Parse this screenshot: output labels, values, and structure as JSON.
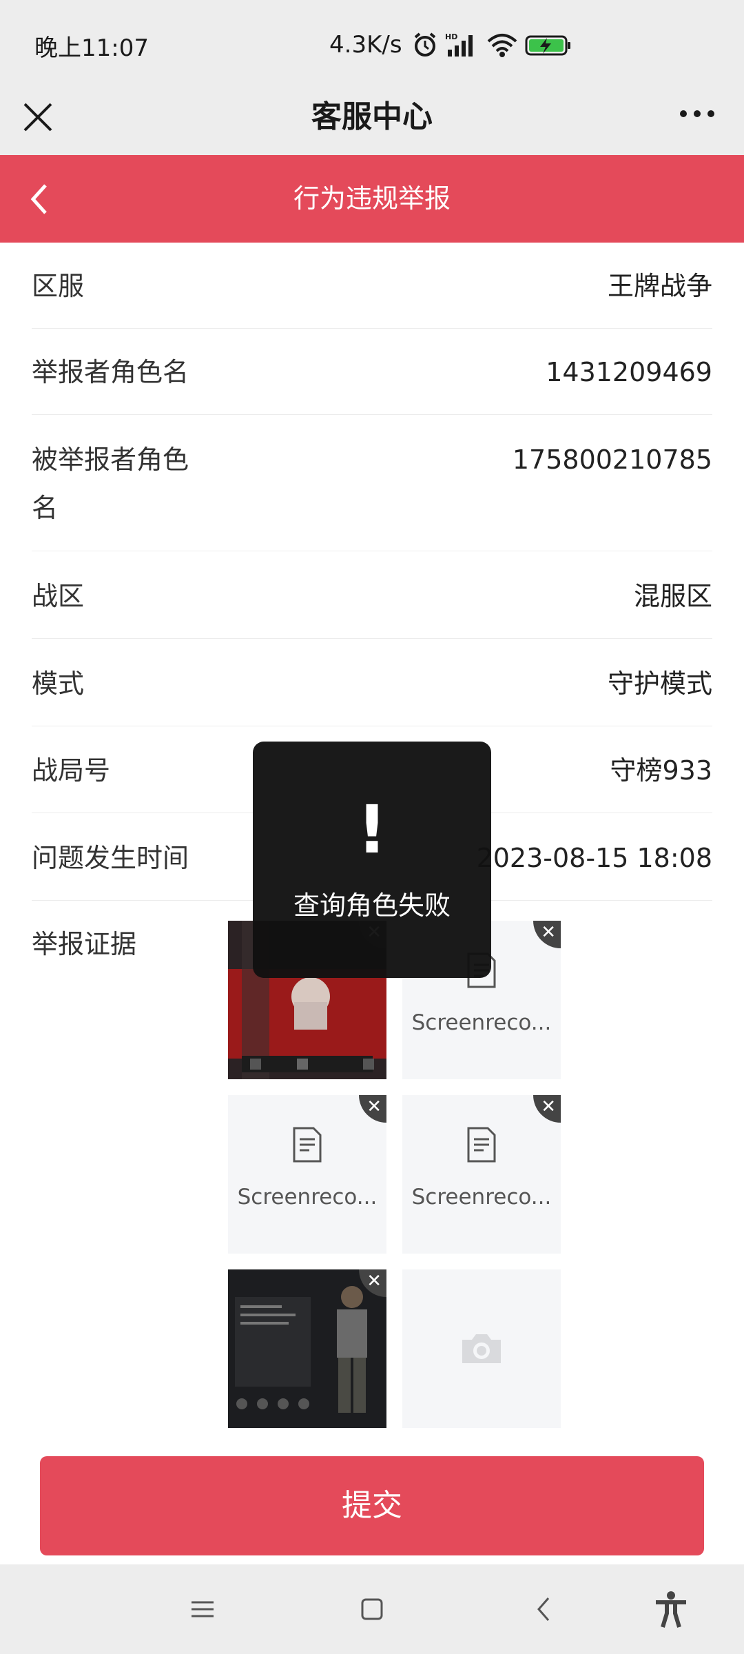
{
  "status_bar": {
    "time": "晚上11:07",
    "net_speed": "4.3K/s",
    "icons": [
      "alarm-icon",
      "hd-signal-icon",
      "wifi-icon",
      "battery-charging-icon"
    ]
  },
  "wechat_bar": {
    "title": "客服中心",
    "close_icon": "close-icon",
    "more_icon": "more-icon"
  },
  "header": {
    "title": "行为违规举报",
    "back_icon": "chevron-left-icon"
  },
  "form": {
    "rows": [
      {
        "label": "区服",
        "value": "王牌战争"
      },
      {
        "label": "举报者角色名",
        "value": "1431209469"
      },
      {
        "label_line1": "被举报者角色",
        "label_line2": "名",
        "value": "175800210785"
      },
      {
        "label": "战区",
        "value": "混服区"
      },
      {
        "label": "模式",
        "value": "守护模式"
      },
      {
        "label": "战局号",
        "value": "守榜933"
      },
      {
        "label": "问题发生时间",
        "value": "2023-08-15 18:08"
      }
    ],
    "evidence_label": "举报证据",
    "evidence": [
      {
        "type": "image"
      },
      {
        "type": "file",
        "name": "Screenreco..."
      },
      {
        "type": "file",
        "name": "Screenreco..."
      },
      {
        "type": "file",
        "name": "Screenreco..."
      },
      {
        "type": "image"
      },
      {
        "type": "add",
        "icon": "camera-icon"
      }
    ],
    "remove_glyph": "✕"
  },
  "submit_label": "提交",
  "toast": {
    "mark": "!",
    "message": "查询角色失败"
  },
  "navbar": {
    "icons": [
      "menu-icon",
      "home-icon",
      "back-icon",
      "accessibility-icon"
    ]
  },
  "colors": {
    "accent": "#e44a5a",
    "bar_bg": "#ededed"
  }
}
